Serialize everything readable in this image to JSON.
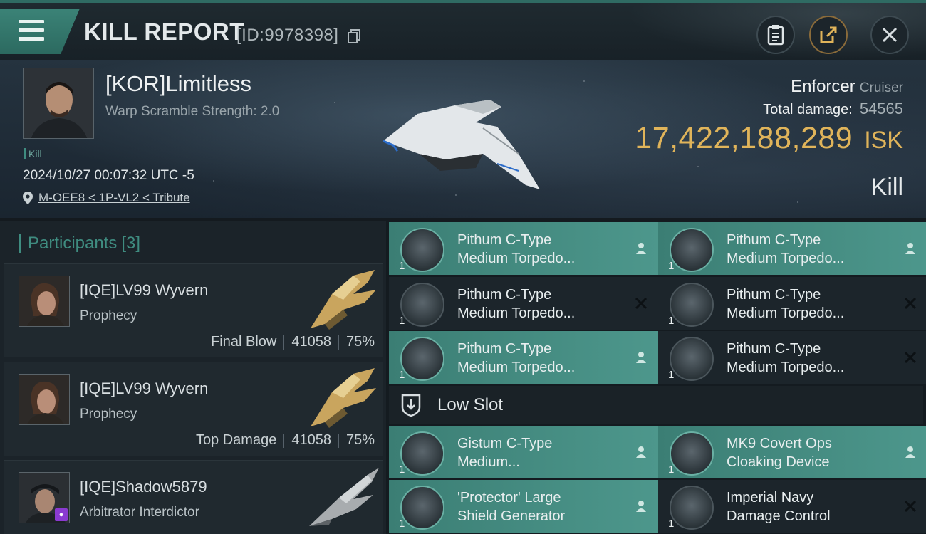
{
  "header": {
    "title": "KILL REPORT",
    "report_id": "[ID:9978398]",
    "buttons": {
      "clipboard": "clipboard-icon",
      "share": "share-icon",
      "close": "close-icon"
    }
  },
  "victim": {
    "name": "[KOR]Limitless",
    "warp_scramble": "Warp Scramble Strength: 2.0",
    "kill_tag": "Kill",
    "datetime": "2024/10/27 00:07:32 UTC -5",
    "location": "M-OEE8 < 1P-VL2 < Tribute",
    "ship_name": "Enforcer",
    "ship_class": "Cruiser",
    "total_damage_label": "Total damage:",
    "total_damage": "54565",
    "isk_value": "17,422,188,289",
    "isk_unit": "ISK",
    "result": "Kill"
  },
  "participants": {
    "label": "Participants",
    "count": "[3]",
    "list": [
      {
        "name": "[IQE]LV99 Wyvern",
        "ship": "Prophecy",
        "role": "Final Blow",
        "damage": "41058",
        "percent": "75%"
      },
      {
        "name": "[IQE]LV99 Wyvern",
        "ship": "Prophecy",
        "role": "Top Damage",
        "damage": "41058",
        "percent": "75%"
      },
      {
        "name": "[IQE]Shadow5879",
        "ship": "Arbitrator Interdictor"
      }
    ]
  },
  "modules": {
    "high": [
      {
        "line1": "Pithum C-Type",
        "line2": "Medium Torpedo...",
        "qty": "1",
        "state": "dropped"
      },
      {
        "line1": "Pithum C-Type",
        "line2": "Medium Torpedo...",
        "qty": "1",
        "state": "dropped"
      },
      {
        "line1": "Pithum C-Type",
        "line2": "Medium Torpedo...",
        "qty": "1",
        "state": "destroyed"
      },
      {
        "line1": "Pithum C-Type",
        "line2": "Medium Torpedo...",
        "qty": "1",
        "state": "destroyed"
      },
      {
        "line1": "Pithum C-Type",
        "line2": "Medium Torpedo...",
        "qty": "1",
        "state": "dropped"
      },
      {
        "line1": "Pithum C-Type",
        "line2": "Medium Torpedo...",
        "qty": "1",
        "state": "destroyed"
      }
    ],
    "low_slot_label": "Low Slot",
    "low": [
      {
        "line1": "Gistum C-Type",
        "line2": "Medium...",
        "qty": "1",
        "state": "dropped"
      },
      {
        "line1": "MK9 Covert Ops",
        "line2": "Cloaking Device",
        "qty": "1",
        "state": "dropped"
      },
      {
        "line1": "'Protector' Large",
        "line2": "Shield Generator",
        "qty": "1",
        "state": "dropped"
      },
      {
        "line1": "Imperial Navy",
        "line2": "Damage Control",
        "qty": "1",
        "state": "destroyed"
      }
    ]
  },
  "colors": {
    "accent": "#3f8c80",
    "isk": "#e0b45a",
    "dropped_bg": "#44897e",
    "destroyed_bg": "#1c252b"
  }
}
